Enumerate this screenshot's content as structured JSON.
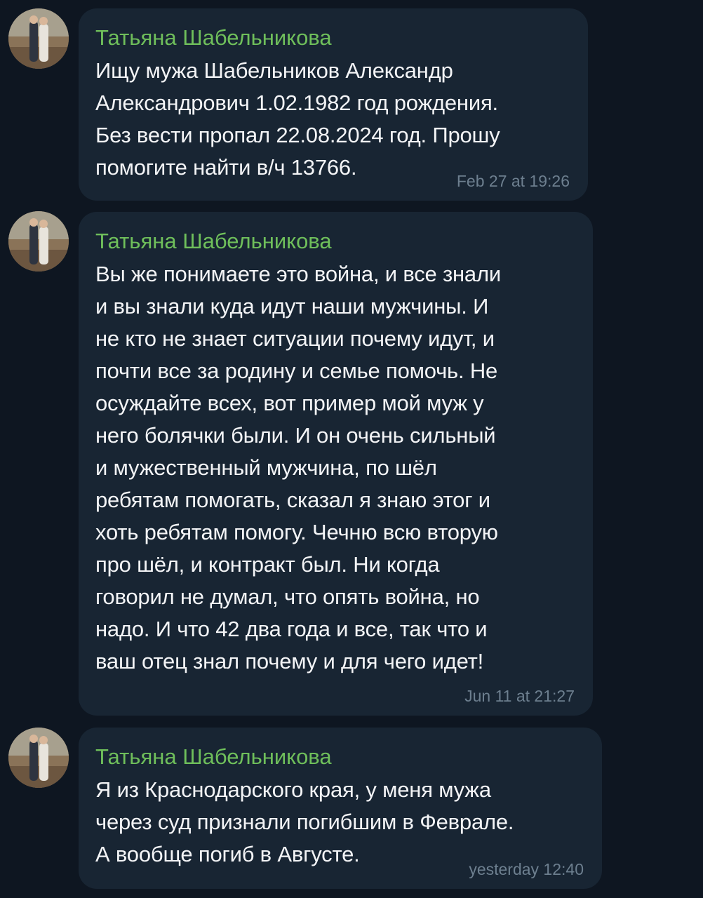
{
  "colors": {
    "background": "#0e1621",
    "bubble": "#182533",
    "sender_name": "#6fbf5b",
    "message_text": "#f3f4f6",
    "timestamp": "#6d7f8f"
  },
  "messages": [
    {
      "sender": "Татьяна Шабельникова",
      "text": "Ищу мужа Шабельников Александр\nАлександрович 1.02.1982 год рождения.\nБез вести пропал 22.08.2024 год. Прошу\nпомогите найти в/ч 13766.",
      "time": "Feb 27 at 19:26"
    },
    {
      "sender": "Татьяна Шабельникова",
      "text": "Вы же понимаете это война, и все знали\nи вы знали куда идут наши мужчины. И\nне кто не знает ситуации почему идут, и\nпочти все за родину и семье помочь. Не\nосуждайте всех, вот пример мой муж у\nнего болячки были. И он очень сильный\nи мужественный мужчина, по шёл\nребятам помогать, сказал я знаю этог и\nхоть ребятам помогу. Чечню всю вторую\nпро шёл, и контракт был. Ни когда\nговорил не думал, что опять война, но\nнадо. И что 42 два года и все, так что и\nваш отец знал почему и для чего идет!",
      "time": "Jun 11 at 21:27"
    },
    {
      "sender": "Татьяна Шабельникова",
      "text": "Я из Краснодарского края, у меня мужа\nчерез суд признали погибшим в Феврале.\nА вообще погиб в Августе.",
      "time": "yesterday 12:40"
    }
  ]
}
